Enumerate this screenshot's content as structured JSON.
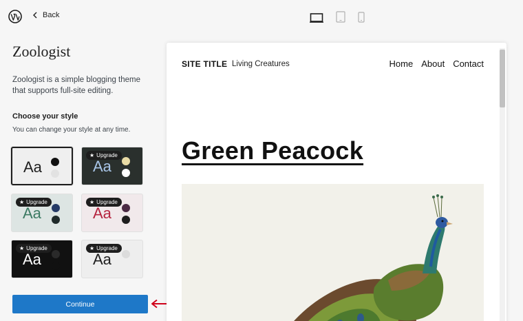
{
  "header": {
    "back_label": "Back"
  },
  "theme": {
    "name": "Zoologist",
    "description": "Zoologist is a simple blogging theme that supports full-site editing."
  },
  "styles": {
    "heading": "Choose your style",
    "subheading": "You can change your style at any time.",
    "sample_text": "Aa",
    "upgrade_label": "Upgrade",
    "items": [
      {
        "bg": "#efefef",
        "text": "#1e1e1e",
        "dot1": "#111111",
        "dot2": "#e2e2e2",
        "selected": true,
        "upgrade": false
      },
      {
        "bg": "#2a302d",
        "text": "#a9c6e8",
        "dot1": "#e9dca6",
        "dot2": "#ffffff",
        "selected": false,
        "upgrade": true
      },
      {
        "bg": "#dde5e3",
        "text": "#3c7a63",
        "dot1": "#253a66",
        "dot2": "#1f2a2a",
        "selected": false,
        "upgrade": true
      },
      {
        "bg": "#f1e9eb",
        "text": "#b5243f",
        "dot1": "#4b2a44",
        "dot2": "#1e1e1e",
        "selected": false,
        "upgrade": true
      },
      {
        "bg": "#111111",
        "text": "#ffffff",
        "dot1": "#2a2a2a",
        "dot2": "#111111",
        "selected": false,
        "upgrade": true
      },
      {
        "bg": "#eeeeee",
        "text": "#1e1e1e",
        "dot1": "#dcdcdc",
        "dot2": "#eeeeee",
        "selected": false,
        "upgrade": true
      }
    ]
  },
  "continue_label": "Continue",
  "preview": {
    "site_title": "SITE TITLE",
    "tagline": "Living Creatures",
    "nav": [
      "Home",
      "About",
      "Contact"
    ],
    "post_title": "Green Peacock"
  },
  "colors": {
    "accent": "#1e78c8",
    "arrow": "#d0021b"
  }
}
